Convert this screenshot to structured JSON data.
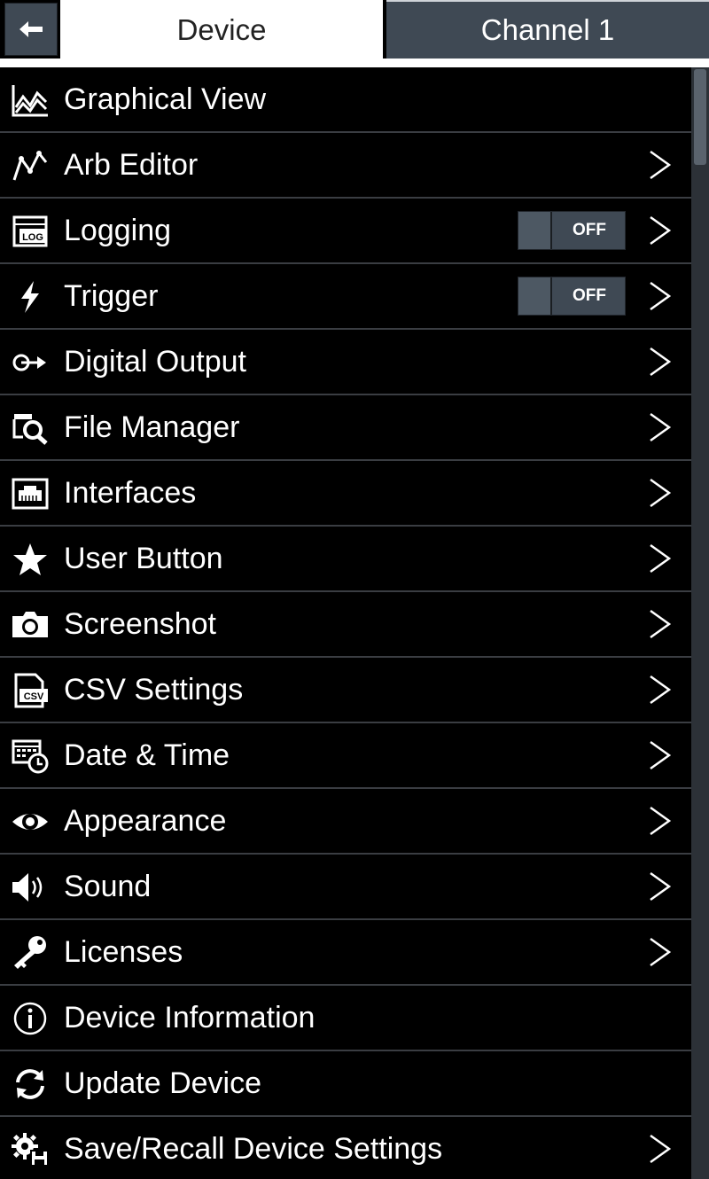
{
  "header": {
    "tabs": [
      {
        "label": "Device",
        "active": true
      },
      {
        "label": "Channel 1",
        "active": false
      }
    ]
  },
  "menu": {
    "items": [
      {
        "label": "Graphical View",
        "icon": "graph-icon",
        "has_chevron": false
      },
      {
        "label": "Arb Editor",
        "icon": "arb-editor-icon",
        "has_chevron": true
      },
      {
        "label": "Logging",
        "icon": "log-icon",
        "has_chevron": true,
        "toggle": "OFF"
      },
      {
        "label": "Trigger",
        "icon": "lightning-icon",
        "has_chevron": true,
        "toggle": "OFF"
      },
      {
        "label": "Digital Output",
        "icon": "digital-output-icon",
        "has_chevron": true
      },
      {
        "label": "File Manager",
        "icon": "file-search-icon",
        "has_chevron": true
      },
      {
        "label": "Interfaces",
        "icon": "ethernet-port-icon",
        "has_chevron": true
      },
      {
        "label": "User Button",
        "icon": "star-icon",
        "has_chevron": true
      },
      {
        "label": "Screenshot",
        "icon": "camera-icon",
        "has_chevron": true
      },
      {
        "label": "CSV Settings",
        "icon": "csv-file-icon",
        "has_chevron": true
      },
      {
        "label": "Date & Time",
        "icon": "calendar-clock-icon",
        "has_chevron": true
      },
      {
        "label": "Appearance",
        "icon": "eye-icon",
        "has_chevron": true
      },
      {
        "label": "Sound",
        "icon": "speaker-icon",
        "has_chevron": true
      },
      {
        "label": "Licenses",
        "icon": "key-icon",
        "has_chevron": true
      },
      {
        "label": "Device Information",
        "icon": "info-icon",
        "has_chevron": false
      },
      {
        "label": "Update Device",
        "icon": "refresh-icon",
        "has_chevron": false
      },
      {
        "label": "Save/Recall Device Settings",
        "icon": "gear-save-icon",
        "has_chevron": true
      }
    ]
  },
  "colors": {
    "background": "#000000",
    "tab_active_bg": "#ffffff",
    "tab_inactive_bg": "#3f4954",
    "divider": "#3a3d42",
    "toggle_bg": "#3f4954"
  }
}
